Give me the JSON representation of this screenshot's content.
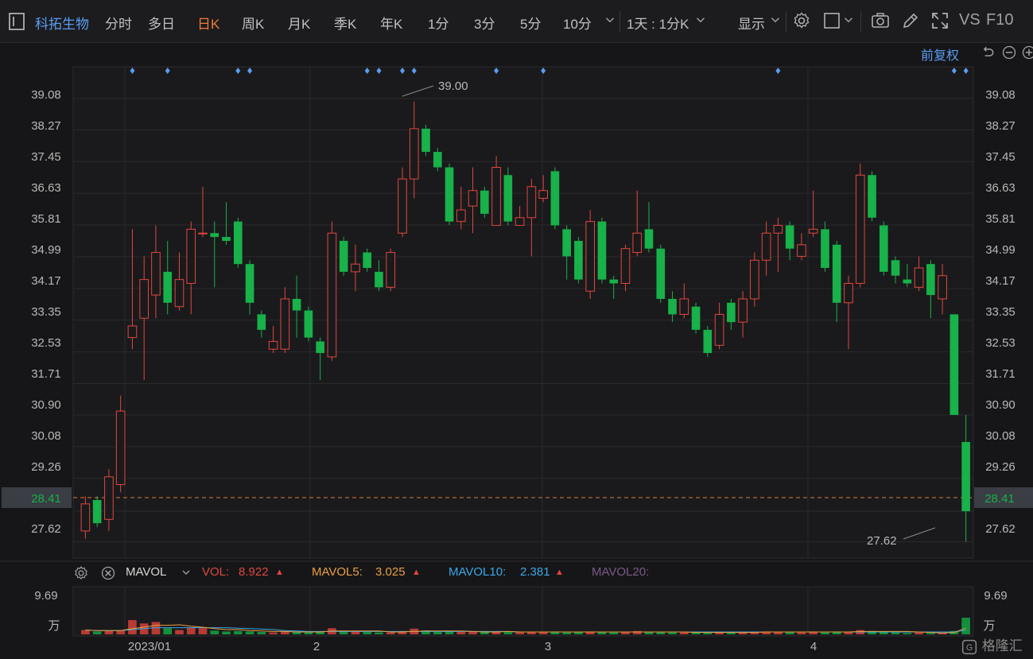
{
  "toolbar": {
    "stock_name": "科拓生物",
    "periods": [
      "分时",
      "多日",
      "日K",
      "周K",
      "月K",
      "季K",
      "年K",
      "1分",
      "3分",
      "5分",
      "10分"
    ],
    "active_period": "日K",
    "interval_label": "1天 : 1分K",
    "display_label": "显示",
    "vs_label": "VS",
    "f10_label": "F10"
  },
  "adjust_label": "前复权",
  "price_axis": [
    "39.08",
    "38.27",
    "37.45",
    "36.63",
    "35.81",
    "34.99",
    "34.17",
    "33.35",
    "32.53",
    "31.71",
    "30.90",
    "30.08",
    "29.26",
    "28.41",
    "27.62"
  ],
  "current_price": "28.41",
  "high_label": "39.00",
  "low_label": "27.62",
  "volume_legend": {
    "indicator": "MAVOL",
    "vol_label": "VOL:",
    "vol_value": "8.922",
    "mavol5_label": "MAVOL5:",
    "mavol5_value": "3.025",
    "mavol10_label": "MAVOL10:",
    "mavol10_value": "2.381",
    "mavol20_label": "MAVOL20:"
  },
  "volume_axis": {
    "max": "9.69",
    "unit": "万"
  },
  "time_axis": [
    "2023/01",
    "2",
    "3",
    "4"
  ],
  "logo_text": "格隆汇",
  "colors": {
    "up": "#e0473f",
    "down": "#18b14a",
    "accent": "#f07a3a",
    "link": "#5b9cf0"
  },
  "chart_data": {
    "type": "candlestick",
    "ylim": [
      27.2,
      39.9
    ],
    "candles": [
      {
        "o": 27.9,
        "c": 28.6,
        "h": 28.8,
        "l": 27.7
      },
      {
        "o": 28.7,
        "c": 28.1,
        "h": 28.8,
        "l": 28.0
      },
      {
        "o": 28.2,
        "c": 29.3,
        "h": 29.5,
        "l": 27.9
      },
      {
        "o": 29.1,
        "c": 31.0,
        "h": 31.4,
        "l": 28.9
      },
      {
        "o": 32.9,
        "c": 33.2,
        "h": 35.7,
        "l": 32.6
      },
      {
        "o": 33.4,
        "c": 34.4,
        "h": 35.0,
        "l": 31.8
      },
      {
        "o": 34.0,
        "c": 35.1,
        "h": 35.8,
        "l": 33.4
      },
      {
        "o": 34.6,
        "c": 33.8,
        "h": 35.4,
        "l": 33.5
      },
      {
        "o": 33.7,
        "c": 34.4,
        "h": 35.1,
        "l": 33.6
      },
      {
        "o": 34.3,
        "c": 35.7,
        "h": 35.9,
        "l": 33.5
      },
      {
        "o": 35.6,
        "c": 35.6,
        "h": 36.8,
        "l": 35.5
      },
      {
        "o": 35.6,
        "c": 35.5,
        "h": 35.9,
        "l": 34.2
      },
      {
        "o": 35.5,
        "c": 35.4,
        "h": 36.4,
        "l": 35.3
      },
      {
        "o": 35.9,
        "c": 34.8,
        "h": 36.0,
        "l": 34.7
      },
      {
        "o": 34.8,
        "c": 33.8,
        "h": 34.9,
        "l": 33.5
      },
      {
        "o": 33.5,
        "c": 33.1,
        "h": 33.6,
        "l": 32.9
      },
      {
        "o": 32.6,
        "c": 32.8,
        "h": 33.2,
        "l": 32.5
      },
      {
        "o": 32.6,
        "c": 33.9,
        "h": 34.2,
        "l": 32.5
      },
      {
        "o": 33.9,
        "c": 33.6,
        "h": 34.5,
        "l": 32.9
      },
      {
        "o": 33.6,
        "c": 32.9,
        "h": 33.7,
        "l": 32.8
      },
      {
        "o": 32.8,
        "c": 32.5,
        "h": 32.9,
        "l": 31.8
      },
      {
        "o": 32.4,
        "c": 35.6,
        "h": 35.9,
        "l": 32.3
      },
      {
        "o": 35.4,
        "c": 34.6,
        "h": 35.5,
        "l": 34.5
      },
      {
        "o": 34.6,
        "c": 34.8,
        "h": 35.3,
        "l": 34.1
      },
      {
        "o": 35.1,
        "c": 34.7,
        "h": 35.2,
        "l": 34.6
      },
      {
        "o": 34.6,
        "c": 34.2,
        "h": 34.9,
        "l": 34.1
      },
      {
        "o": 34.2,
        "c": 35.1,
        "h": 35.2,
        "l": 34.1
      },
      {
        "o": 35.6,
        "c": 37.0,
        "h": 37.3,
        "l": 35.5
      },
      {
        "o": 37.0,
        "c": 38.3,
        "h": 39.0,
        "l": 36.5
      },
      {
        "o": 38.3,
        "c": 37.7,
        "h": 38.4,
        "l": 37.6
      },
      {
        "o": 37.7,
        "c": 37.3,
        "h": 37.8,
        "l": 37.2
      },
      {
        "o": 37.3,
        "c": 35.9,
        "h": 37.4,
        "l": 35.8
      },
      {
        "o": 35.9,
        "c": 36.2,
        "h": 36.8,
        "l": 35.7
      },
      {
        "o": 36.3,
        "c": 36.7,
        "h": 37.3,
        "l": 35.6
      },
      {
        "o": 36.7,
        "c": 36.1,
        "h": 36.8,
        "l": 36.0
      },
      {
        "o": 35.8,
        "c": 37.3,
        "h": 37.6,
        "l": 35.8
      },
      {
        "o": 37.1,
        "c": 35.9,
        "h": 37.3,
        "l": 35.8
      },
      {
        "o": 35.8,
        "c": 36.0,
        "h": 36.3,
        "l": 35.8
      },
      {
        "o": 36.0,
        "c": 36.8,
        "h": 37.0,
        "l": 35.0
      },
      {
        "o": 36.5,
        "c": 36.7,
        "h": 37.1,
        "l": 36.4
      },
      {
        "o": 37.2,
        "c": 35.8,
        "h": 37.3,
        "l": 35.7
      },
      {
        "o": 35.7,
        "c": 35.0,
        "h": 35.8,
        "l": 34.4
      },
      {
        "o": 35.4,
        "c": 34.4,
        "h": 35.5,
        "l": 34.3
      },
      {
        "o": 34.1,
        "c": 35.9,
        "h": 36.2,
        "l": 33.9
      },
      {
        "o": 35.9,
        "c": 34.4,
        "h": 36.0,
        "l": 34.3
      },
      {
        "o": 34.4,
        "c": 34.3,
        "h": 34.5,
        "l": 33.9
      },
      {
        "o": 34.3,
        "c": 35.2,
        "h": 35.3,
        "l": 34.1
      },
      {
        "o": 35.1,
        "c": 35.6,
        "h": 36.7,
        "l": 35.0
      },
      {
        "o": 35.7,
        "c": 35.2,
        "h": 36.4,
        "l": 35.1
      },
      {
        "o": 35.2,
        "c": 33.9,
        "h": 35.3,
        "l": 33.8
      },
      {
        "o": 33.9,
        "c": 33.5,
        "h": 34.1,
        "l": 33.3
      },
      {
        "o": 33.5,
        "c": 33.9,
        "h": 34.3,
        "l": 33.4
      },
      {
        "o": 33.7,
        "c": 33.1,
        "h": 33.8,
        "l": 33.0
      },
      {
        "o": 33.1,
        "c": 32.5,
        "h": 33.2,
        "l": 32.4
      },
      {
        "o": 32.7,
        "c": 33.5,
        "h": 33.8,
        "l": 32.6
      },
      {
        "o": 33.8,
        "c": 33.3,
        "h": 33.9,
        "l": 33.1
      },
      {
        "o": 33.3,
        "c": 33.9,
        "h": 34.1,
        "l": 32.9
      },
      {
        "o": 33.9,
        "c": 34.9,
        "h": 35.1,
        "l": 33.7
      },
      {
        "o": 34.9,
        "c": 35.6,
        "h": 35.9,
        "l": 34.5
      },
      {
        "o": 35.6,
        "c": 35.8,
        "h": 36.0,
        "l": 34.6
      },
      {
        "o": 35.8,
        "c": 35.2,
        "h": 35.9,
        "l": 34.9
      },
      {
        "o": 35.0,
        "c": 35.3,
        "h": 35.6,
        "l": 34.9
      },
      {
        "o": 35.6,
        "c": 35.7,
        "h": 36.7,
        "l": 35.5
      },
      {
        "o": 35.7,
        "c": 34.7,
        "h": 35.9,
        "l": 34.6
      },
      {
        "o": 35.3,
        "c": 33.8,
        "h": 35.4,
        "l": 33.3
      },
      {
        "o": 33.8,
        "c": 34.3,
        "h": 34.5,
        "l": 32.6
      },
      {
        "o": 34.3,
        "c": 37.1,
        "h": 37.4,
        "l": 34.2
      },
      {
        "o": 37.1,
        "c": 36.0,
        "h": 37.2,
        "l": 35.9
      },
      {
        "o": 35.8,
        "c": 34.6,
        "h": 35.9,
        "l": 34.5
      },
      {
        "o": 34.9,
        "c": 34.5,
        "h": 35.0,
        "l": 34.3
      },
      {
        "o": 34.4,
        "c": 34.3,
        "h": 34.8,
        "l": 34.2
      },
      {
        "o": 34.2,
        "c": 34.7,
        "h": 35.0,
        "l": 34.1
      },
      {
        "o": 34.8,
        "c": 34.0,
        "h": 34.9,
        "l": 33.4
      },
      {
        "o": 33.9,
        "c": 34.5,
        "h": 34.8,
        "l": 33.5
      },
      {
        "o": 33.5,
        "c": 30.9,
        "h": 33.5,
        "l": 30.9
      },
      {
        "o": 30.2,
        "c": 28.41,
        "h": 30.9,
        "l": 27.62
      }
    ],
    "volumes": [
      0.9,
      0.6,
      0.7,
      0.8,
      3.0,
      2.3,
      2.6,
      1.3,
      0.9,
      1.5,
      1.3,
      0.8,
      0.6,
      0.7,
      0.6,
      0.5,
      0.4,
      0.6,
      0.5,
      0.4,
      0.5,
      1.3,
      0.7,
      0.6,
      0.5,
      0.4,
      0.4,
      0.7,
      1.2,
      0.8,
      0.5,
      0.6,
      0.5,
      0.6,
      0.5,
      0.5,
      0.6,
      0.4,
      0.5,
      0.5,
      0.6,
      0.4,
      0.5,
      0.6,
      0.5,
      0.4,
      0.5,
      0.7,
      0.5,
      0.5,
      0.4,
      0.4,
      0.4,
      0.4,
      0.5,
      0.4,
      0.4,
      0.5,
      0.6,
      0.5,
      0.5,
      0.4,
      0.6,
      0.4,
      0.6,
      0.5,
      0.9,
      0.7,
      0.5,
      0.4,
      0.3,
      0.4,
      0.3,
      0.3,
      0.7,
      3.5
    ],
    "mavol5": [
      0.9,
      0.8,
      0.8,
      0.8,
      1.2,
      1.5,
      1.9,
      1.9,
      2.0,
      1.7,
      1.5,
      1.2,
      1.0,
      1.0,
      0.8,
      0.7,
      0.6,
      0.6,
      0.5,
      0.5,
      0.5,
      0.7,
      0.7,
      0.7,
      0.7,
      0.7,
      0.5,
      0.5,
      0.6,
      0.7,
      0.7,
      0.7,
      0.7,
      0.6,
      0.5,
      0.5,
      0.6,
      0.5,
      0.5,
      0.5,
      0.5,
      0.5,
      0.5,
      0.5,
      0.5,
      0.5,
      0.5,
      0.5,
      0.5,
      0.5,
      0.5,
      0.5,
      0.4,
      0.4,
      0.4,
      0.4,
      0.4,
      0.4,
      0.5,
      0.5,
      0.5,
      0.5,
      0.5,
      0.5,
      0.5,
      0.5,
      0.6,
      0.6,
      0.6,
      0.6,
      0.6,
      0.5,
      0.4,
      0.3,
      0.4,
      1.3
    ],
    "mavol10": [
      0.9,
      0.8,
      0.8,
      0.8,
      1.0,
      1.2,
      1.4,
      1.4,
      1.4,
      1.4,
      1.4,
      1.4,
      1.4,
      1.3,
      1.2,
      1.1,
      1.0,
      0.8,
      0.7,
      0.6,
      0.6,
      0.6,
      0.6,
      0.6,
      0.6,
      0.6,
      0.6,
      0.6,
      0.6,
      0.6,
      0.6,
      0.6,
      0.6,
      0.6,
      0.6,
      0.6,
      0.6,
      0.5,
      0.5,
      0.5,
      0.5,
      0.5,
      0.5,
      0.5,
      0.5,
      0.5,
      0.5,
      0.5,
      0.5,
      0.5,
      0.5,
      0.5,
      0.5,
      0.5,
      0.5,
      0.5,
      0.5,
      0.5,
      0.5,
      0.5,
      0.5,
      0.5,
      0.5,
      0.5,
      0.5,
      0.5,
      0.5,
      0.5,
      0.5,
      0.5,
      0.5,
      0.5,
      0.5,
      0.5,
      0.5,
      0.9
    ],
    "volume_ylim": [
      0,
      9.69
    ],
    "event_markers": [
      4,
      7,
      13,
      14,
      24,
      25,
      27,
      28,
      35,
      39,
      59,
      74,
      75
    ]
  }
}
